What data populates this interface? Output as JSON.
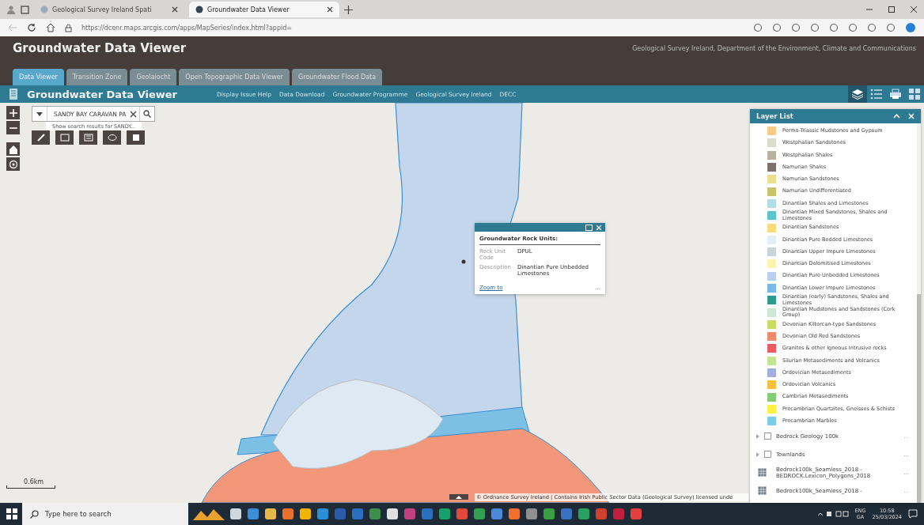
{
  "browser": {
    "tabs": [
      {
        "title": "Geological Survey Ireland Spati",
        "selected": false
      },
      {
        "title": "Groundwater Data Viewer",
        "selected": true
      }
    ],
    "url": "https://dcenr.maps.arcgis.com/apps/MapSeries/index.html?appid="
  },
  "header": {
    "title": "Groundwater Data Viewer",
    "subtitle": "Geological Survey Ireland, Department of the Environment, Climate and Communications"
  },
  "tabs": [
    {
      "label": "Data Viewer",
      "selected": true
    },
    {
      "label": "Transition Zone",
      "selected": false
    },
    {
      "label": "Geolaiocht",
      "selected": false
    },
    {
      "label": "Open Topographic Data Viewer",
      "selected": false
    },
    {
      "label": "Groundwater Flood Data",
      "selected": false
    }
  ],
  "app_bar": {
    "title": "Groundwater Data Viewer",
    "links": [
      "Display Issue Help",
      "Data Download",
      "Groundwater Programme",
      "Geological Survey Ireland",
      "DECC"
    ]
  },
  "search": {
    "value": "SANDY BAY CARAVAN PA",
    "suggestion": "Show search results for SANDY..."
  },
  "popup": {
    "title": "Groundwater Rock Units:",
    "fields": [
      {
        "label": "Rock Unit Code",
        "value": "DPUL"
      },
      {
        "label": "Description",
        "value": "Dinantian Pure Unbedded Limestones"
      }
    ],
    "link": "Zoom to",
    "more": "..."
  },
  "layer_list": {
    "title": "Layer List",
    "legend": [
      {
        "label": "Permo-Triassic Mudstones and Gypsum",
        "color": "#f7c98a"
      },
      {
        "label": "Westphalian Sandstones",
        "color": "#dcdccb"
      },
      {
        "label": "Westphalian Shales",
        "color": "#b9b0a0"
      },
      {
        "label": "Namurian Shales",
        "color": "#7c7070"
      },
      {
        "label": "Namurian Sandstones",
        "color": "#e8e08e"
      },
      {
        "label": "Namurian Undifferentiated",
        "color": "#c8c46a"
      },
      {
        "label": "Dinantian Shales and Limestones",
        "color": "#b4dce6"
      },
      {
        "label": "Dinantian Mixed Sandstones, Shales and Limestones",
        "color": "#5cc4c8"
      },
      {
        "label": "Dinantian Sandstones",
        "color": "#f8dc7c"
      },
      {
        "label": "Dinantian Pure Bedded Limestones",
        "color": "#e2eef4"
      },
      {
        "label": "Dinantian Upper Impure Limestones",
        "color": "#c8d4d8"
      },
      {
        "label": "Dinantian Dolomitised Limestones",
        "color": "#fbf4b0"
      },
      {
        "label": "Dinantian Pure Unbedded Limestones",
        "color": "#b8d0ec"
      },
      {
        "label": "Dinantian Lower Impure Limestones",
        "color": "#7ab8e8"
      },
      {
        "label": "Dinantian (early) Sandstones, Shales and Limestones",
        "color": "#2e9a8c"
      },
      {
        "label": "Dinantian Mudstones and Sandstones (Cork Group)",
        "color": "#cce8d2"
      },
      {
        "label": "Devonian Kiltorcan-type Sandstones",
        "color": "#c8dc64"
      },
      {
        "label": "Devonian Old Red Sandstones",
        "color": "#f08a6c"
      },
      {
        "label": "Granites & other Igneous Intrusive rocks",
        "color": "#ee5a5e"
      },
      {
        "label": "Silurian Metasediments and Volcanics",
        "color": "#c4e494"
      },
      {
        "label": "Ordovician Metasediments",
        "color": "#a4aede"
      },
      {
        "label": "Ordovician Volcanics",
        "color": "#f8c040"
      },
      {
        "label": "Cambrian Metasediments",
        "color": "#84cc74"
      },
      {
        "label": "Precambrian Quartzites, Gneisses & Schists",
        "color": "#fcf040"
      },
      {
        "label": "Precambrian Marbles",
        "color": "#7ccce8"
      }
    ],
    "layers": [
      {
        "kind": "group",
        "name": "Bedrock Geology 100k",
        "checked": false,
        "more": "..."
      },
      {
        "kind": "group",
        "name": "Townlands",
        "checked": false,
        "more": "..."
      },
      {
        "kind": "table",
        "name": "Bedrock100k_Seamless_2018 - BEDROCK.Lexicon_Polygons_2018",
        "more": "..."
      },
      {
        "kind": "table",
        "name": "Bedrock100k_Seamless_2018 -",
        "more": "..."
      }
    ]
  },
  "map": {
    "scale": "0.6km",
    "attribution": "© Ordnance Survey Ireland | Contains Irish Public Sector Data (Geological Survey) licensed unde"
  },
  "taskbar": {
    "search_placeholder": "Type here to search",
    "language": "ENG",
    "layout": "GA",
    "time": "10:58",
    "date": "25/03/2024"
  }
}
